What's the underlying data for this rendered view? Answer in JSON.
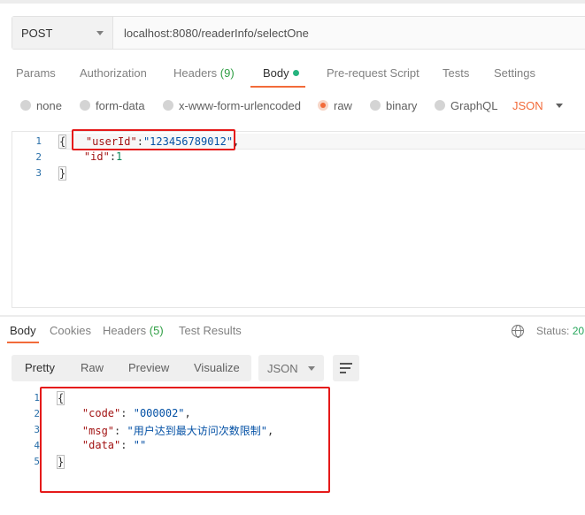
{
  "request": {
    "method": "POST",
    "url": "localhost:8080/readerInfo/selectOne"
  },
  "req_tabs": {
    "params": "Params",
    "authorization": "Authorization",
    "headers": "Headers",
    "headers_count": "(9)",
    "body": "Body",
    "prerequest": "Pre-request Script",
    "tests": "Tests",
    "settings": "Settings"
  },
  "body_types": {
    "none": "none",
    "form_data": "form-data",
    "urlencoded": "x-www-form-urlencoded",
    "raw": "raw",
    "binary": "binary",
    "graphql": "GraphQL",
    "language": "JSON",
    "selected": "raw"
  },
  "request_body": {
    "line_numbers": [
      "1",
      "2",
      "3"
    ],
    "open_brace": "{",
    "userId_key": "\"userId\"",
    "userId_value": "\"123456789012\"",
    "id_key": "\"id\"",
    "id_value": "1",
    "close_brace": "}",
    "colon": ":",
    "comma": ","
  },
  "res_tabs": {
    "body": "Body",
    "cookies": "Cookies",
    "headers": "Headers",
    "headers_count": "(5)",
    "test_results": "Test Results"
  },
  "status": {
    "label": "Status:",
    "value": "20"
  },
  "view_modes": {
    "pretty": "Pretty",
    "raw": "Raw",
    "preview": "Preview",
    "visualize": "Visualize",
    "format": "JSON"
  },
  "response_body": {
    "line_numbers": [
      "1",
      "2",
      "3",
      "4",
      "5"
    ],
    "open_brace": "{",
    "code_key": "\"code\"",
    "code_value": "\"000002\"",
    "msg_key": "\"msg\"",
    "msg_value": "\"用户达到最大访问次数限制\"",
    "data_key": "\"data\"",
    "data_value": "\"\"",
    "close_brace": "}",
    "colon": ": ",
    "comma": ","
  },
  "colors": {
    "accent": "#f26b3a",
    "annotation": "#e51a1a",
    "success": "#26a65b"
  }
}
